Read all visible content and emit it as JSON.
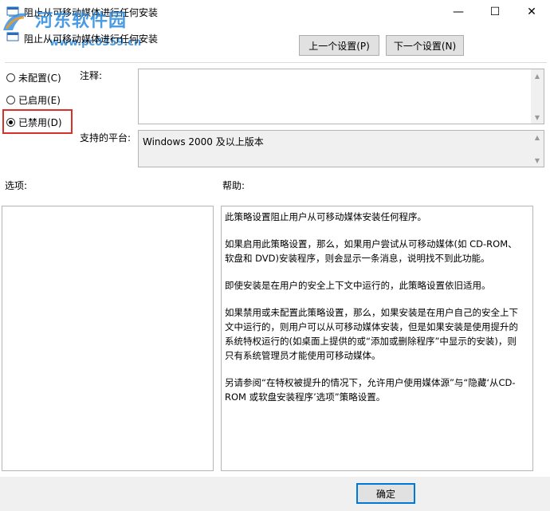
{
  "window": {
    "title": "阻止从可移动媒体进行任何安装",
    "buttons": {
      "minimize": "—",
      "maximize": "☐",
      "close": "✕"
    }
  },
  "watermark": {
    "main": "河东软件园",
    "url": "www.pc0359.cn"
  },
  "header": {
    "policy_name": "阻止从可移动媒体进行任何安装"
  },
  "nav": {
    "prev": "上一个设置(P)",
    "next": "下一个设置(N)"
  },
  "radios": [
    {
      "label": "未配置(C)",
      "selected": false
    },
    {
      "label": "已启用(E)",
      "selected": false
    },
    {
      "label": "已禁用(D)",
      "selected": true
    }
  ],
  "comment": {
    "label": "注释:",
    "value": ""
  },
  "platform": {
    "label": "支持的平台:",
    "value": "Windows 2000 及以上版本"
  },
  "options": {
    "label": "选项:"
  },
  "help": {
    "label": "帮助:",
    "paragraphs": [
      "此策略设置阻止用户从可移动媒体安装任何程序。",
      "如果启用此策略设置，那么，如果用户尝试从可移动媒体(如 CD-ROM、软盘和 DVD)安装程序，则会显示一条消息，说明找不到此功能。",
      "即使安装是在用户的安全上下文中运行的，此策略设置依旧适用。",
      "如果禁用或未配置此策略设置，那么，如果安装是在用户自己的安全上下文中运行的，则用户可以从可移动媒体安装，但是如果安装是使用提升的系统特权运行的(如桌面上提供的或“添加或删除程序”中显示的安装)，则只有系统管理员才能使用可移动媒体。",
      "另请参阅“在特权被提升的情况下，允许用户使用媒体源”与“隐藏‘从CD-ROM 或软盘安装程序’选项”策略设置。"
    ]
  },
  "footer": {
    "ok": "确定"
  },
  "colors": {
    "accent": "#0078d7",
    "highlight": "#d9302a",
    "watermark": "#2a8be0"
  }
}
